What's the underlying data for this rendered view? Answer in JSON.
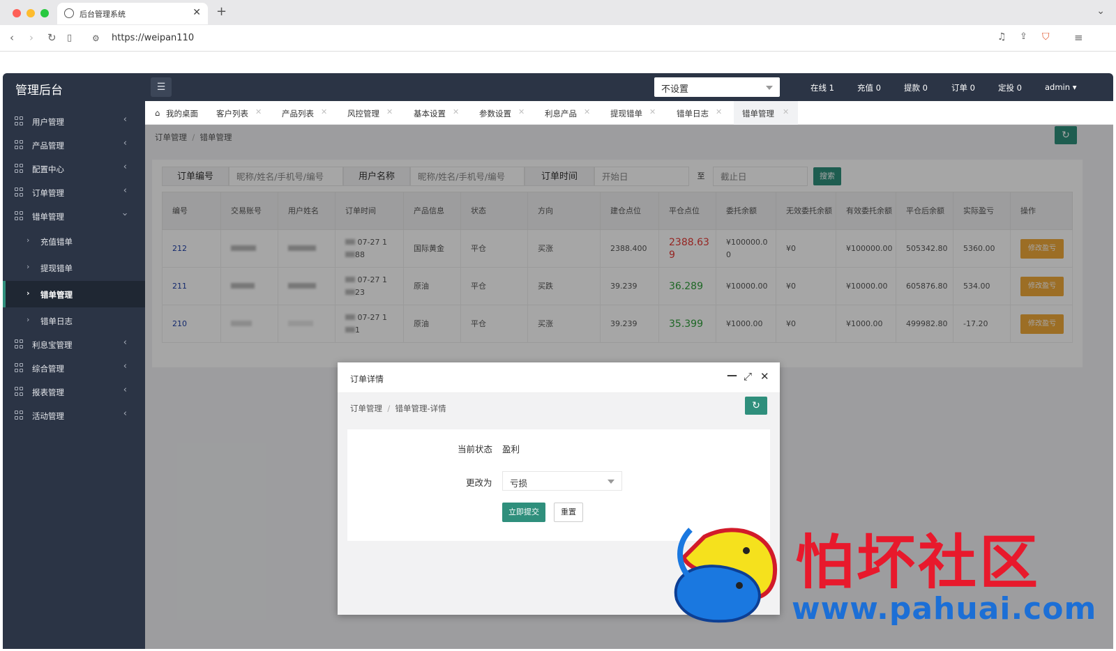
{
  "browser": {
    "tab_title": "后台管理系统",
    "url": "https://weipan110"
  },
  "app": {
    "logo": "管理后台",
    "mode_select": "不设置",
    "stats": [
      "在线 1",
      "充值 0",
      "提款 0",
      "订单 0",
      "定投 0"
    ],
    "user": "admin"
  },
  "sidebar": {
    "items": [
      {
        "label": "用户管理"
      },
      {
        "label": "产品管理"
      },
      {
        "label": "配置中心"
      },
      {
        "label": "订单管理"
      },
      {
        "label": "错单管理"
      }
    ],
    "subitems": [
      {
        "label": "充值错单"
      },
      {
        "label": "提现错单"
      },
      {
        "label": "错单管理"
      },
      {
        "label": "错单日志"
      }
    ],
    "items2": [
      {
        "label": "利息宝管理"
      },
      {
        "label": "综合管理"
      },
      {
        "label": "报表管理"
      },
      {
        "label": "活动管理"
      }
    ]
  },
  "tabs": [
    "我的桌面",
    "客户列表",
    "产品列表",
    "风控管理",
    "基本设置",
    "参数设置",
    "利息产品",
    "提现错单",
    "错单日志",
    "错单管理"
  ],
  "breadcrumb": {
    "parent": "订单管理",
    "sep": "/",
    "current": "错单管理"
  },
  "filters": {
    "order_no": "订单编号",
    "user_name": "用户名称",
    "placeholder": "昵称/姓名/手机号/编号",
    "order_time": "订单时间",
    "start": "开始日",
    "to": "至",
    "end": "截止日",
    "search": "搜索"
  },
  "table": {
    "headers": [
      "编号",
      "交易账号",
      "用户姓名",
      "订单时间",
      "产品信息",
      "状态",
      "方向",
      "建仓点位",
      "平仓点位",
      "委托余额",
      "无效委托余额",
      "有效委托余额",
      "平仓后余额",
      "实际盈亏",
      "操作"
    ],
    "rows": [
      {
        "id": "212",
        "time": "07-27 1",
        "time2": "88",
        "product": "国际黄金",
        "status": "平仓",
        "dir": "买涨",
        "open": "2388.400",
        "close": "2388.63",
        "close2": "9",
        "entrust": "¥100000.0",
        "entrust2": "0",
        "invalid": "¥0",
        "valid": "¥100000.00",
        "after": "505342.80",
        "pnl": "5360.00",
        "action": "修改盈亏"
      },
      {
        "id": "211",
        "time": "07-27 1",
        "time2": "23",
        "product": "原油",
        "status": "平仓",
        "dir": "买跌",
        "open": "39.239",
        "close": "36.289",
        "close2": "",
        "entrust": "¥10000.00",
        "entrust2": "",
        "invalid": "¥0",
        "valid": "¥10000.00",
        "after": "605876.80",
        "pnl": "534.00",
        "action": "修改盈亏"
      },
      {
        "id": "210",
        "time": "07-27 1",
        "time2": "1",
        "product": "原油",
        "status": "平仓",
        "dir": "买涨",
        "open": "39.239",
        "close": "35.399",
        "close2": "",
        "entrust": "¥1000.00",
        "entrust2": "",
        "invalid": "¥0",
        "valid": "¥1000.00",
        "after": "499982.80",
        "pnl": "-17.20",
        "action": "修改盈亏"
      }
    ]
  },
  "modal": {
    "title": "订单详情",
    "crumb_parent": "订单管理",
    "crumb_sep": "/",
    "crumb_current": "错单管理-详情",
    "status_label": "当前状态",
    "status_value": "盈利",
    "change_label": "更改为",
    "change_value": "亏损",
    "submit": "立即提交",
    "reset": "重置"
  },
  "watermark": {
    "text": "怕坏社区",
    "url": "www.pahuai.com"
  }
}
